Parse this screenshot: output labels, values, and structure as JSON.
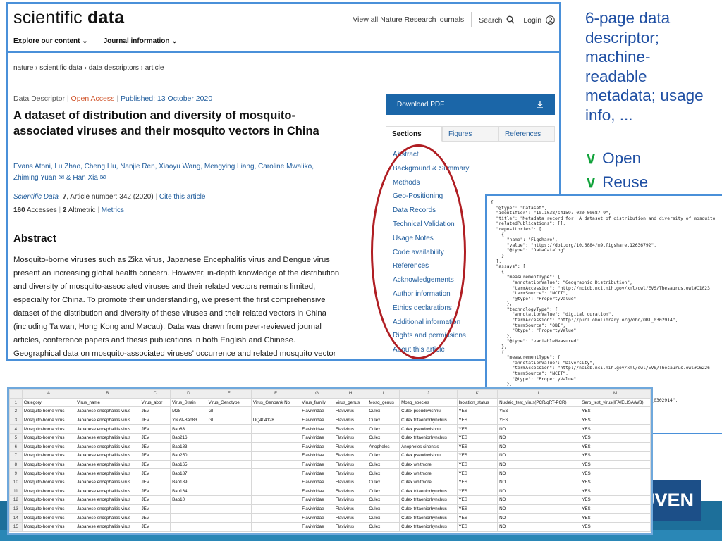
{
  "annotation": {
    "lines": [
      "6-page data",
      "descriptor;",
      "machine-",
      "readable",
      "metadata; usage",
      "info, ..."
    ],
    "checks": [
      {
        "mark": "∨",
        "label": "Open"
      },
      {
        "mark": "∨",
        "label": "Reuse"
      }
    ]
  },
  "logo_text": "UVEN",
  "article": {
    "brand_light": "scientific ",
    "brand_bold": "data",
    "top_links": {
      "journals": "View all Nature Research journals",
      "search": "Search",
      "login": "Login"
    },
    "nav": [
      "Explore our content",
      "Journal information"
    ],
    "breadcrumb": "nature › scientific data › data descriptors › article",
    "meta": {
      "type": "Data Descriptor",
      "access": "Open Access",
      "published": "Published: 13 October 2020"
    },
    "title": "A dataset of distribution and diversity of mosquito-associated viruses and their mosquito vectors in China",
    "authors": "Evans Atoni, Lu Zhao, Cheng Hu, Nanjie Ren, Xiaoyu Wang, Mengying Liang, Caroline Mwaliko, Zhiming Yuan ✉ & Han Xia ✉",
    "citation": {
      "journal": "Scientific Data",
      "volume": "7",
      "article": ", Article number: 342 (2020)",
      "cite": "Cite this article"
    },
    "metrics": {
      "accesses_n": "160",
      "accesses": "Accesses",
      "altmetric_n": "2",
      "altmetric": "Altmetric",
      "metrics": "Metrics"
    },
    "abstract_heading": "Abstract",
    "abstract_text": "Mosquito-borne viruses such as Zika virus, Japanese Encephalitis virus and Dengue virus present an increasing global health concern. However, in-depth knowledge of the distribution and diversity of mosquito-associated viruses and their related vectors remains limited, especially for China. To promote their understanding, we present the first comprehensive dataset of the distribution and diversity of these viruses and their related vectors in China (including Taiwan, Hong Kong and Macau). Data was drawn from peer-reviewed journal articles, conference papers and thesis publications in both English and Chinese. Geographical data on mosquito-associated viruses' occurrence and related mosquito vector species was",
    "download": "Download PDF",
    "tabs": [
      "Sections",
      "Figures",
      "References"
    ],
    "sections": [
      "Abstract",
      "Background & Summary",
      "Methods",
      "Geo-Positioning",
      "Data Records",
      "Technical Validation",
      "Usage Notes",
      "Code availability",
      "References",
      "Acknowledgements",
      "Author information",
      "Ethics declarations",
      "Additional information",
      "Rights and permissions",
      "About this article"
    ]
  },
  "json_panel": [
    "{",
    "  \"@type\": \"Dataset\",",
    "  \"identifier\": \"10.1038/s41597-020-00687-9\",",
    "  \"title\": \"Metadata record for: A dataset of distribution and diversity of mosquito",
    "  \"relatedPublications\": [],",
    "  \"repositories\": [",
    "    {",
    "      \"name\": \"Figshare\",",
    "      \"value\": \"https://doi.org/10.6084/m9.figshare.12636792\",",
    "      \"@type\": \"DataCatalog\"",
    "    }",
    "  ],",
    "  \"assays\": [",
    "    {",
    "      \"measurementType\": {",
    "        \"annotationValue\": \"Geographic Distribution\",",
    "        \"termAccession\": \"http://ncicb.nci.nih.gov/xml/owl/EVS/Thesaurus.owl#C1023",
    "        \"termSource\": \"NCIT\",",
    "        \"@type\": \"PropertyValue\"",
    "      },",
    "      \"technologyType\": {",
    "        \"annotationValue\": \"digital curation\",",
    "        \"termAccession\": \"http://purl.obolibrary.org/obo/OBI_0302914\",",
    "        \"termSource\": \"OBI\",",
    "        \"@type\": \"PropertyValue\"",
    "      },",
    "      \"@type\": \"variableMeasured\"",
    "    },",
    "    {",
    "      \"measurementType\": {",
    "        \"annotationValue\": \"Diversity\",",
    "        \"termAccession\": \"http://ncicb.nci.nih.gov/xml/owl/EVS/Thesaurus.owl#C6226",
    "        \"termSource\": \"NCIT\",",
    "        \"@type\": \"PropertyValue\"",
    "      },",
    "      \"technologyType\": {",
    "        \"annotationValue\": \"digital curation\",",
    "        \"termAccession\": \"http://purl.obolibrary.org/obo/OBI_0302914\",",
    "        \"termSource\": \"OBI\",",
    "        \"@type\": \"PropertyValue\"",
    "      },"
  ],
  "sheet": {
    "col_letters": [
      "",
      "A",
      "B",
      "C",
      "D",
      "E",
      "F",
      "G",
      "H",
      "I",
      "J",
      "K",
      "L",
      "M"
    ],
    "rows": [
      [
        "1",
        "Category",
        "Virus_name",
        "Virus_abbr",
        "Virus_Strain",
        "Virus_Genotype",
        "Virus_Genbank No",
        "Virus_family",
        "Virus_genus",
        "Mosq_genus",
        "Mosq_species",
        "Isolation_status",
        "Nucleic_test_virus(PCR/qRT-PCR)",
        "Sero_test_virus(IFA/ELISA/WB)"
      ],
      [
        "2",
        "Mosquito-borne virus",
        "Japanese encephalitis virus",
        "JEV",
        "M28",
        "GI",
        "",
        "Flaviviridae",
        "Flavivirus",
        "Culex",
        "Culex pseudovishnui",
        "YES",
        "YES",
        "YES"
      ],
      [
        "3",
        "Mosquito-borne virus",
        "Japanese encephalitis virus",
        "JEV",
        "YN79-Bao83",
        "GI",
        "DQ404128",
        "Flaviviridae",
        "Flavivirus",
        "Culex",
        "Culex tritaeniorhynchus",
        "YES",
        "YES",
        "YES"
      ],
      [
        "4",
        "Mosquito-borne virus",
        "Japanese encephalitis virus",
        "JEV",
        "Bao83",
        "",
        "",
        "Flaviviridae",
        "Flavivirus",
        "Culex",
        "Culex pseudovishnui",
        "YES",
        "NO",
        "YES"
      ],
      [
        "5",
        "Mosquito-borne virus",
        "Japanese encephalitis virus",
        "JEV",
        "Bao216",
        "",
        "",
        "Flaviviridae",
        "Flavivirus",
        "Culex",
        "Culex tritaeniorhynchus",
        "YES",
        "NO",
        "YES"
      ],
      [
        "6",
        "Mosquito-borne virus",
        "Japanese encephalitis virus",
        "JEV",
        "Bao183",
        "",
        "",
        "Flaviviridae",
        "Flavivirus",
        "Anopheles",
        "Anopheles sinensis",
        "YES",
        "NO",
        "YES"
      ],
      [
        "7",
        "Mosquito-borne virus",
        "Japanese encephalitis virus",
        "JEV",
        "Bao250",
        "",
        "",
        "Flaviviridae",
        "Flavivirus",
        "Culex",
        "Culex pseudovishnui",
        "YES",
        "NO",
        "YES"
      ],
      [
        "8",
        "Mosquito-borne virus",
        "Japanese encephalitis virus",
        "JEV",
        "Bao165",
        "",
        "",
        "Flaviviridae",
        "Flavivirus",
        "Culex",
        "Culex whitmorei",
        "YES",
        "NO",
        "YES"
      ],
      [
        "9",
        "Mosquito-borne virus",
        "Japanese encephalitis virus",
        "JEV",
        "Bao187",
        "",
        "",
        "Flaviviridae",
        "Flavivirus",
        "Culex",
        "Culex whitmorei",
        "YES",
        "NO",
        "YES"
      ],
      [
        "10",
        "Mosquito-borne virus",
        "Japanese encephalitis virus",
        "JEV",
        "Bao189",
        "",
        "",
        "Flaviviridae",
        "Flavivirus",
        "Culex",
        "Culex whitmorei",
        "YES",
        "NO",
        "YES"
      ],
      [
        "11",
        "Mosquito-borne virus",
        "Japanese encephalitis virus",
        "JEV",
        "Bao164",
        "",
        "",
        "Flaviviridae",
        "Flavivirus",
        "Culex",
        "Culex tritaeniorhynchus",
        "YES",
        "NO",
        "YES"
      ],
      [
        "12",
        "Mosquito-borne virus",
        "Japanese encephalitis virus",
        "JEV",
        "Bao10",
        "",
        "",
        "Flaviviridae",
        "Flavivirus",
        "Culex",
        "Culex tritaeniorhynchus",
        "YES",
        "NO",
        "YES"
      ],
      [
        "13",
        "Mosquito-borne virus",
        "Japanese encephalitis virus",
        "JEV",
        "",
        "",
        "",
        "Flaviviridae",
        "Flavivirus",
        "Culex",
        "Culex tritaeniorhynchus",
        "YES",
        "NO",
        "YES"
      ],
      [
        "14",
        "Mosquito-borne virus",
        "Japanese encephalitis virus",
        "JEV",
        "",
        "",
        "",
        "Flaviviridae",
        "Flavivirus",
        "Culex",
        "Culex tritaeniorhynchus",
        "YES",
        "NO",
        "YES"
      ],
      [
        "15",
        "Mosquito-borne virus",
        "Japanese encephalitis virus",
        "JEV",
        "",
        "",
        "",
        "Flaviviridae",
        "Flavivirus",
        "Culex",
        "Culex tritaeniorhynchus",
        "YES",
        "NO",
        "YES"
      ]
    ]
  }
}
